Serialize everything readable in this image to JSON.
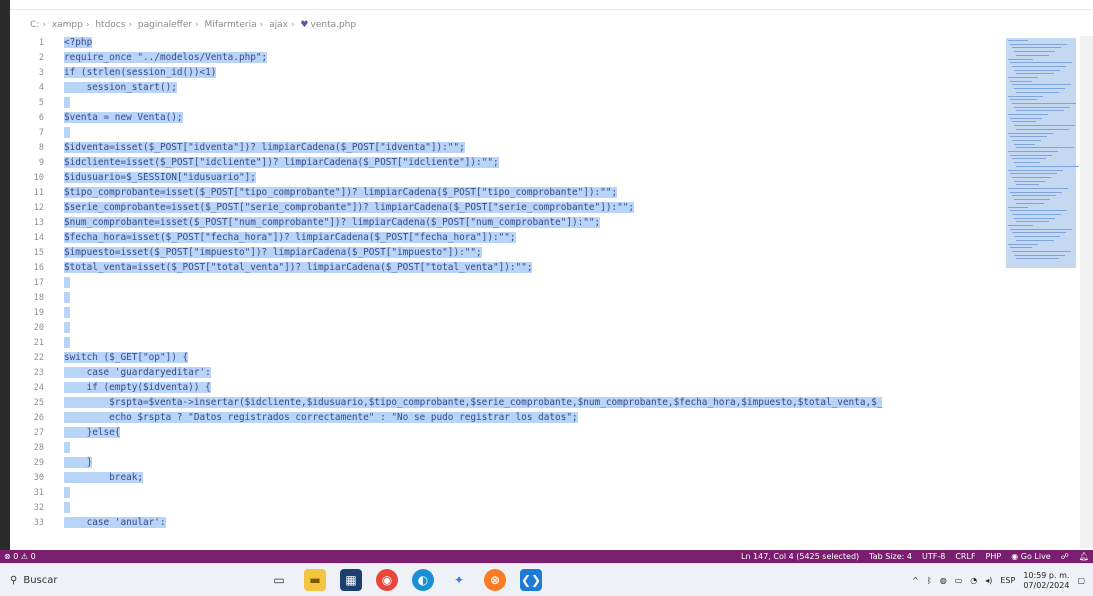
{
  "breadcrumb": [
    "C:",
    "xampp",
    "htdocs",
    "paginaleffer",
    "Mifarmteria",
    "ajax",
    "venta.php"
  ],
  "code_lines": [
    {
      "n": "1",
      "text": "<?php"
    },
    {
      "n": "2",
      "text": "require_once \"../modelos/Venta.php\";"
    },
    {
      "n": "3",
      "text": "if (strlen(session_id())<1)"
    },
    {
      "n": "4",
      "text": "    session_start();"
    },
    {
      "n": "5",
      "text": ""
    },
    {
      "n": "6",
      "text": "$venta = new Venta();"
    },
    {
      "n": "7",
      "text": ""
    },
    {
      "n": "8",
      "text": "$idventa=isset($_POST[\"idventa\"])? limpiarCadena($_POST[\"idventa\"]):\"\";"
    },
    {
      "n": "9",
      "text": "$idcliente=isset($_POST[\"idcliente\"])? limpiarCadena($_POST[\"idcliente\"]):\"\";"
    },
    {
      "n": "10",
      "text": "$idusuario=$_SESSION[\"idusuario\"];"
    },
    {
      "n": "11",
      "text": "$tipo_comprobante=isset($_POST[\"tipo_comprobante\"])? limpiarCadena($_POST[\"tipo_comprobante\"]):\"\";"
    },
    {
      "n": "12",
      "text": "$serie_comprobante=isset($_POST[\"serie_comprobante\"])? limpiarCadena($_POST[\"serie_comprobante\"]):\"\";"
    },
    {
      "n": "13",
      "text": "$num_comprobante=isset($_POST[\"num_comprobante\"])? limpiarCadena($_POST[\"num_comprobante\"]):\"\";"
    },
    {
      "n": "14",
      "text": "$fecha_hora=isset($_POST[\"fecha_hora\"])? limpiarCadena($_POST[\"fecha_hora\"]):\"\";"
    },
    {
      "n": "15",
      "text": "$impuesto=isset($_POST[\"impuesto\"])? limpiarCadena($_POST[\"impuesto\"]):\"\";"
    },
    {
      "n": "16",
      "text": "$total_venta=isset($_POST[\"total_venta\"])? limpiarCadena($_POST[\"total_venta\"]):\"\";"
    },
    {
      "n": "17",
      "text": ""
    },
    {
      "n": "18",
      "text": ""
    },
    {
      "n": "19",
      "text": ""
    },
    {
      "n": "20",
      "text": ""
    },
    {
      "n": "21",
      "text": ""
    },
    {
      "n": "22",
      "text": "switch ($_GET[\"op\"]) {"
    },
    {
      "n": "23",
      "text": "    case 'guardaryeditar':"
    },
    {
      "n": "24",
      "text": "    if (empty($idventa)) {"
    },
    {
      "n": "25",
      "text": "        $rspta=$venta->insertar($idcliente,$idusuario,$tipo_comprobante,$serie_comprobante,$num_comprobante,$fecha_hora,$impuesto,$total_venta,$_"
    },
    {
      "n": "26",
      "text": "        echo $rspta ? \"Datos registrados correctamente\" : \"No se pudo registrar los datos\";"
    },
    {
      "n": "27",
      "text": "    }else{"
    },
    {
      "n": "28",
      "text": ""
    },
    {
      "n": "29",
      "text": "    }"
    },
    {
      "n": "30",
      "text": "        break;"
    },
    {
      "n": "31",
      "text": ""
    },
    {
      "n": "32",
      "text": ""
    },
    {
      "n": "33",
      "text": "    case 'anular':"
    }
  ],
  "statusbar": {
    "problems": "⊗ 0 ⚠ 0",
    "position": "Ln 147, Col 4 (5425 selected)",
    "tab_size": "Tab Size: 4",
    "encoding": "UTF-8",
    "eol": "CRLF",
    "language": "PHP",
    "go_live": "Go Live"
  },
  "taskbar": {
    "search_placeholder": "Buscar",
    "language": "ESP",
    "time": "10:59 p. m.",
    "date": "07/02/2024"
  },
  "colors": {
    "selection": "#b8d4f7",
    "statusbar": "#7a1f6f",
    "taskbar": "#eef1f6"
  }
}
